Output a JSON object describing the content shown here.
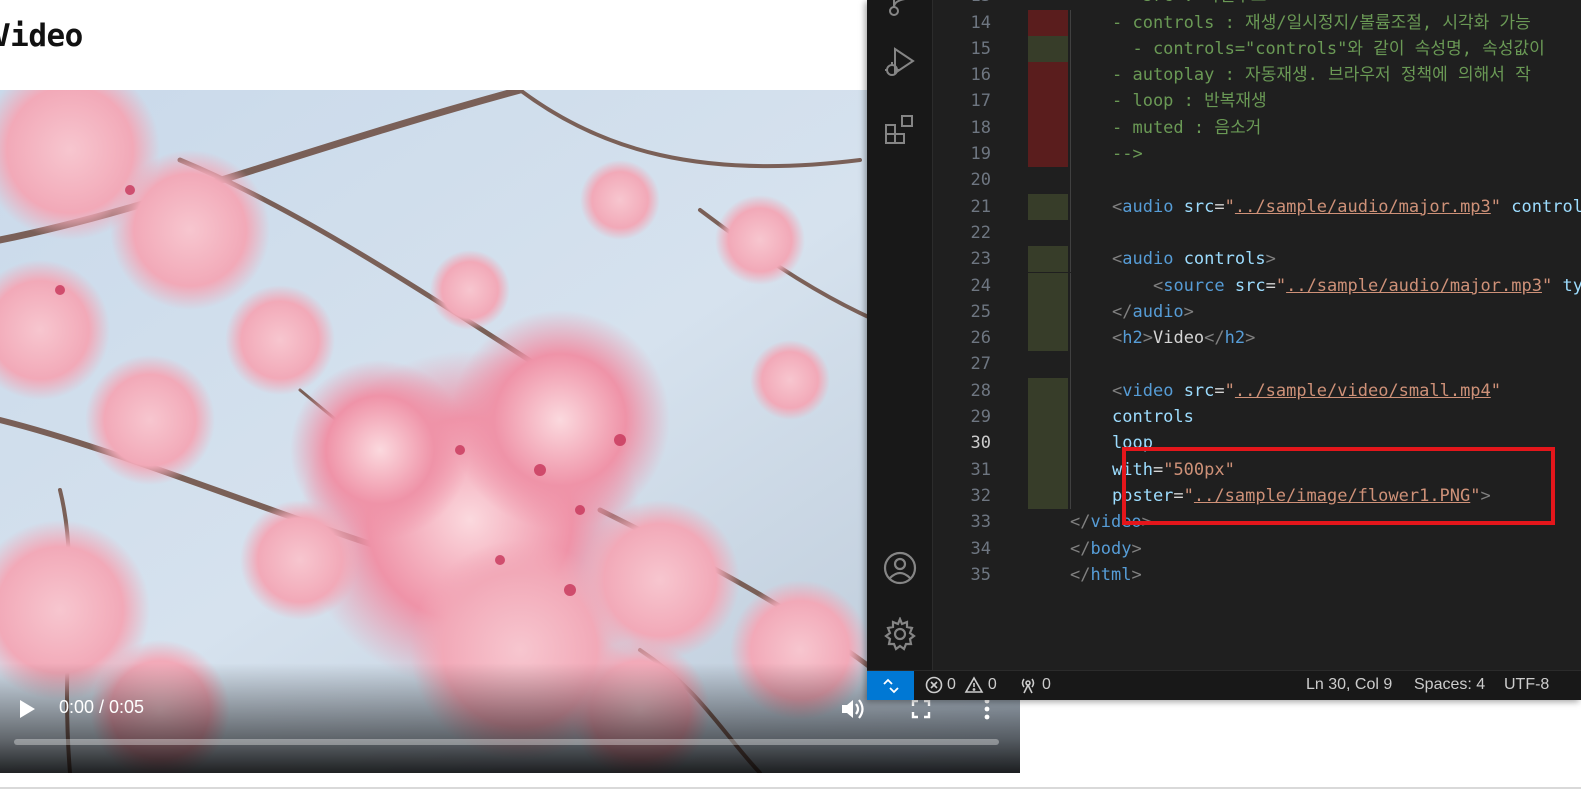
{
  "page": {
    "heading": "Video"
  },
  "video": {
    "time": "0:00 / 0:05",
    "progress_fraction": 0.0,
    "icons": [
      "play-icon",
      "volume-icon",
      "fullscreen-icon",
      "more-vert-icon"
    ]
  },
  "editor": {
    "active_line": 30,
    "lines": [
      {
        "n": "14",
        "gutter": "red",
        "indent": 1,
        "tokens": [
          [
            "c-comment",
            "- controls : 재생/일시정지/볼륨조절, 시각화 가능"
          ]
        ]
      },
      {
        "n": "15",
        "gutter": "green",
        "indent": 2,
        "tokens": [
          [
            "c-comment",
            "  - controls=\"controls\"와 같이 속성명, 속성값이"
          ]
        ]
      },
      {
        "n": "16",
        "gutter": "red",
        "indent": 1,
        "tokens": [
          [
            "c-comment",
            "- autoplay : 자동재생. 브라우저 정책에 의해서 작"
          ]
        ]
      },
      {
        "n": "17",
        "gutter": "red",
        "indent": 1,
        "tokens": [
          [
            "c-comment",
            "- loop : 반복재생"
          ]
        ]
      },
      {
        "n": "18",
        "gutter": "red",
        "indent": 1,
        "tokens": [
          [
            "c-comment",
            "- muted : 음소거"
          ]
        ]
      },
      {
        "n": "19",
        "gutter": "red",
        "indent": 1,
        "tokens": [
          [
            "c-comment",
            "-->"
          ]
        ]
      },
      {
        "n": "20",
        "gutter": "none",
        "indent": 1,
        "tokens": []
      },
      {
        "n": "21",
        "gutter": "green",
        "indent": 1,
        "tokens": [
          [
            "c-bracket",
            "<"
          ],
          [
            "c-tag",
            "audio"
          ],
          [
            "c-text",
            " "
          ],
          [
            "c-attr",
            "src"
          ],
          [
            "c-text",
            "="
          ],
          [
            "c-str",
            "\""
          ],
          [
            "c-str c-link",
            "../sample/audio/major.mp3"
          ],
          [
            "c-str",
            "\""
          ],
          [
            "c-text",
            " "
          ],
          [
            "c-attr",
            "controls"
          ]
        ]
      },
      {
        "n": "22",
        "gutter": "none",
        "indent": 1,
        "tokens": []
      },
      {
        "n": "23",
        "gutter": "green",
        "indent": 1,
        "tokens": [
          [
            "c-bracket",
            "<"
          ],
          [
            "c-tag",
            "audio"
          ],
          [
            "c-text",
            " "
          ],
          [
            "c-attr",
            "controls"
          ],
          [
            "c-bracket",
            ">"
          ]
        ]
      },
      {
        "n": "24",
        "gutter": "green",
        "indent": 2,
        "tokens": [
          [
            "c-text",
            "    "
          ],
          [
            "c-bracket",
            "<"
          ],
          [
            "c-tag",
            "source"
          ],
          [
            "c-text",
            " "
          ],
          [
            "c-attr",
            "src"
          ],
          [
            "c-text",
            "="
          ],
          [
            "c-str",
            "\""
          ],
          [
            "c-str c-link",
            "../sample/audio/major.mp3"
          ],
          [
            "c-str",
            "\""
          ],
          [
            "c-text",
            " "
          ],
          [
            "c-attr",
            "typ"
          ]
        ]
      },
      {
        "n": "25",
        "gutter": "green",
        "indent": 1,
        "tokens": [
          [
            "c-bracket",
            "</"
          ],
          [
            "c-tag",
            "audio"
          ],
          [
            "c-bracket",
            ">"
          ]
        ]
      },
      {
        "n": "26",
        "gutter": "green",
        "indent": 1,
        "tokens": [
          [
            "c-bracket",
            "<"
          ],
          [
            "c-tag",
            "h2"
          ],
          [
            "c-bracket",
            ">"
          ],
          [
            "c-text",
            "Video"
          ],
          [
            "c-bracket",
            "</"
          ],
          [
            "c-tag",
            "h2"
          ],
          [
            "c-bracket",
            ">"
          ]
        ]
      },
      {
        "n": "27",
        "gutter": "none",
        "indent": 1,
        "tokens": []
      },
      {
        "n": "28",
        "gutter": "green",
        "indent": 1,
        "tokens": [
          [
            "c-bracket",
            "<"
          ],
          [
            "c-tag",
            "video"
          ],
          [
            "c-text",
            " "
          ],
          [
            "c-attr",
            "src"
          ],
          [
            "c-text",
            "="
          ],
          [
            "c-str",
            "\""
          ],
          [
            "c-str c-link",
            "../sample/video/small.mp4"
          ],
          [
            "c-str",
            "\""
          ]
        ]
      },
      {
        "n": "29",
        "gutter": "green",
        "indent": 1,
        "tokens": [
          [
            "c-attr",
            "controls"
          ]
        ]
      },
      {
        "n": "30",
        "gutter": "green",
        "indent": 1,
        "tokens": [
          [
            "c-attr",
            "loop"
          ]
        ]
      },
      {
        "n": "31",
        "gutter": "green",
        "indent": 1,
        "tokens": [
          [
            "c-attr",
            "with"
          ],
          [
            "c-text",
            "="
          ],
          [
            "c-str",
            "\"500px\""
          ]
        ]
      },
      {
        "n": "32",
        "gutter": "green",
        "indent": 1,
        "tokens": [
          [
            "c-attr",
            "poster"
          ],
          [
            "c-text",
            "="
          ],
          [
            "c-str",
            "\""
          ],
          [
            "c-str c-link",
            "../sample/image/flower1.PNG"
          ],
          [
            "c-str",
            "\""
          ],
          [
            "c-bracket",
            ">"
          ]
        ]
      },
      {
        "n": "33",
        "gutter": "none",
        "indent": 0,
        "tokens": [
          [
            "c-bracket",
            "</"
          ],
          [
            "c-tag",
            "video"
          ],
          [
            "c-bracket",
            ">"
          ]
        ]
      },
      {
        "n": "34",
        "gutter": "none",
        "indent": 0,
        "tokens": [
          [
            "c-bracket",
            "</"
          ],
          [
            "c-tag",
            "body"
          ],
          [
            "c-bracket",
            ">"
          ]
        ]
      },
      {
        "n": "35",
        "gutter": "none",
        "indent": 0,
        "tokens": [
          [
            "c-bracket",
            "</"
          ],
          [
            "c-tag",
            "html"
          ],
          [
            "c-bracket",
            ">"
          ]
        ]
      }
    ],
    "top_partial_line": {
      "n": "13",
      "tokens": [
        [
          "c-comment",
          "- src : 파일주소"
        ]
      ]
    }
  },
  "activity_bar": {
    "icons": [
      "source-control-icon",
      "run-debug-icon",
      "extensions-icon",
      "account-icon",
      "settings-gear-icon"
    ]
  },
  "status_bar": {
    "errors": "0",
    "warnings": "0",
    "ports": "0",
    "cursor": "Ln 30, Col 9",
    "spaces": "Spaces: 4",
    "encoding": "UTF-8"
  },
  "colors": {
    "highlight_box": "#e4161b",
    "status_remote": "#0078d4",
    "gutter_deleted": "#5a1d1d",
    "gutter_added": "#373d29"
  }
}
